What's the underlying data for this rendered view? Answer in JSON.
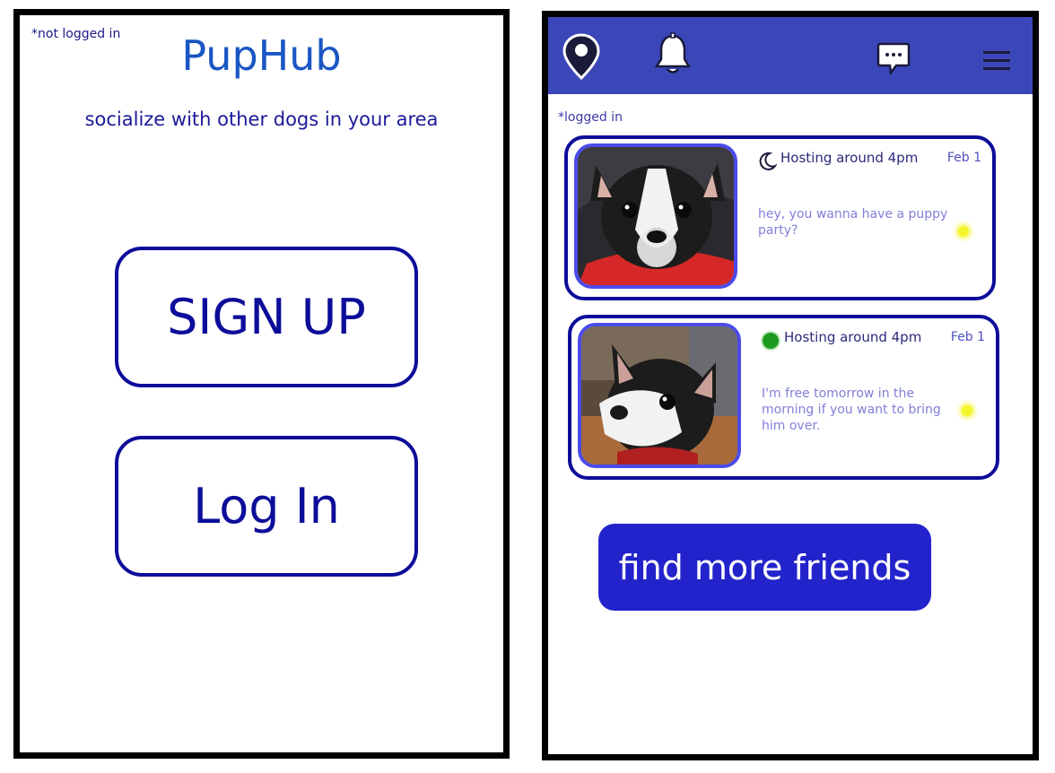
{
  "left_screen": {
    "status": "*not logged in",
    "title": "PupHub",
    "tagline": "socialize with other dogs in your area",
    "signup_label": "SIGN UP",
    "login_label": "Log In"
  },
  "right_screen": {
    "status": "*logged in",
    "topbar": {
      "color": "#3b47b8",
      "icons": [
        "location-pin-icon",
        "bell-icon",
        "chat-icon",
        "menu-icon"
      ]
    },
    "messages": [
      {
        "status_icon": "moon-icon",
        "heading": "Hosting around 4pm",
        "date": "Feb 1",
        "text": "hey,  you wanna have a puppy party?",
        "unread": true
      },
      {
        "status_icon": "online-dot-icon",
        "heading": "Hosting around 4pm",
        "date": "Feb 1",
        "text": "I'm free tomorrow in the morning if you want to bring him over.",
        "unread": true
      }
    ],
    "find_friends_label": "find more friends"
  },
  "colors": {
    "accent": "#0d0d9a",
    "title": "#1a56c4",
    "button_fill": "#2323cc",
    "unread_dot": "#f4f42a",
    "online": "#1e9a1e"
  }
}
